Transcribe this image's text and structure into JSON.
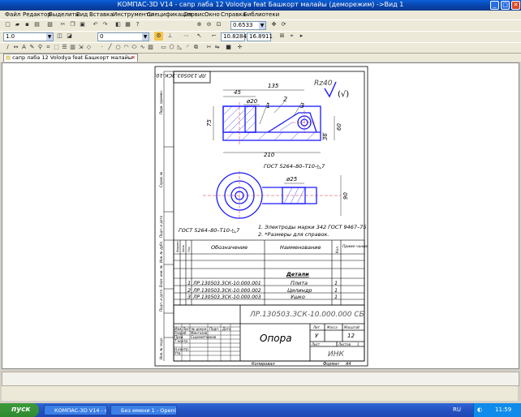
{
  "window": {
    "title": "КОМПАС-3D V14 - сапр лаба 12 Volodya feat Башкорт малайы (деморежим) ->Вид 1"
  },
  "menu": [
    "Файл",
    "Редактор",
    "Выделить",
    "Вид",
    "Вставка",
    "Инструменты",
    "Спецификация",
    "Сервис",
    "Окно",
    "Справка",
    "Библиотеки"
  ],
  "toolbar": {
    "zoom": "0.6533",
    "x_coord": "10.8284",
    "y_coord": "16.8911",
    "line_scale": "1.0",
    "layer": "0"
  },
  "tab": {
    "label": "сапр лаба 12 Volodya feat Башкорт малайы",
    "close": "✕"
  },
  "drawing": {
    "doc_code_rotated": "ЛР.130503.ЗСК-10.000.000 СБ",
    "roughness": "Rz40",
    "dims": {
      "d45": "45",
      "d135": "135",
      "d20": "ø20",
      "d75": "75",
      "d60": "60",
      "d210": "210",
      "d36": "36",
      "d25": "ø25",
      "d90": "90"
    },
    "leaders": [
      "1",
      "2",
      "3"
    ],
    "weld1": "ГОСТ 5264–80–Т10–◺7",
    "weld2": "ГОСТ 5264–80–Т10–◺7",
    "notes": [
      "1. Электроды марки 342 ГОСТ 9467–75",
      "2. *Размеры для справок."
    ],
    "spec": {
      "headers": {
        "designation": "Обозначение",
        "name": "Наименование",
        "qty": "Кол.",
        "note": "Приме-чание",
        "format": "Формат",
        "zone": "Зона",
        "pos": "Поз."
      },
      "section": "Детали",
      "rows": [
        {
          "pos": "1",
          "code": "ЛР.130503.ЗСК-10.000.001",
          "name": "Плита",
          "qty": "1"
        },
        {
          "pos": "2",
          "code": "ЛР.130503.ЗСК-10.000.002",
          "name": "Цилиндр",
          "qty": "1"
        },
        {
          "pos": "3",
          "code": "ЛР.130503.ЗСК-10.000.003",
          "name": "Ушко",
          "qty": "1"
        }
      ]
    },
    "titleblock": {
      "doc_code": "ЛР.130503.ЗСК-10.000.000 СБ",
      "name": "Опора",
      "lit_label": "Лит.",
      "mass_label": "Масса",
      "scale_label": "Масштаб",
      "lit": "У",
      "scale": "12",
      "sheet_label": "Лист",
      "sheets_label": "Листов",
      "sheets": "1",
      "org": "ИНК",
      "roles": [
        "Изм.",
        "Лист",
        "№ докум.",
        "Подп.",
        "Дата"
      ],
      "people": [
        "Разраб.",
        "Пров.",
        "Т.контр.",
        "Н.контр.",
        "Утв."
      ],
      "names": [
        "Мингазов",
        "Сыромятников"
      ],
      "copied": "Копировал",
      "format": "Формат",
      "format_val": "A4"
    },
    "side_labels": [
      "Перв. примен.",
      "Справ. №",
      "Подп. и дата",
      "Инв. № дубл.",
      "Взам. инв. №",
      "Подп. и дата",
      "Инв. № подл."
    ]
  },
  "taskbar": {
    "start": "пуск",
    "tasks": [
      "КОМПАС-3D V14 - са...",
      "Без имени 1 - OpenO..."
    ],
    "lang": "RU",
    "time": "11:59"
  }
}
